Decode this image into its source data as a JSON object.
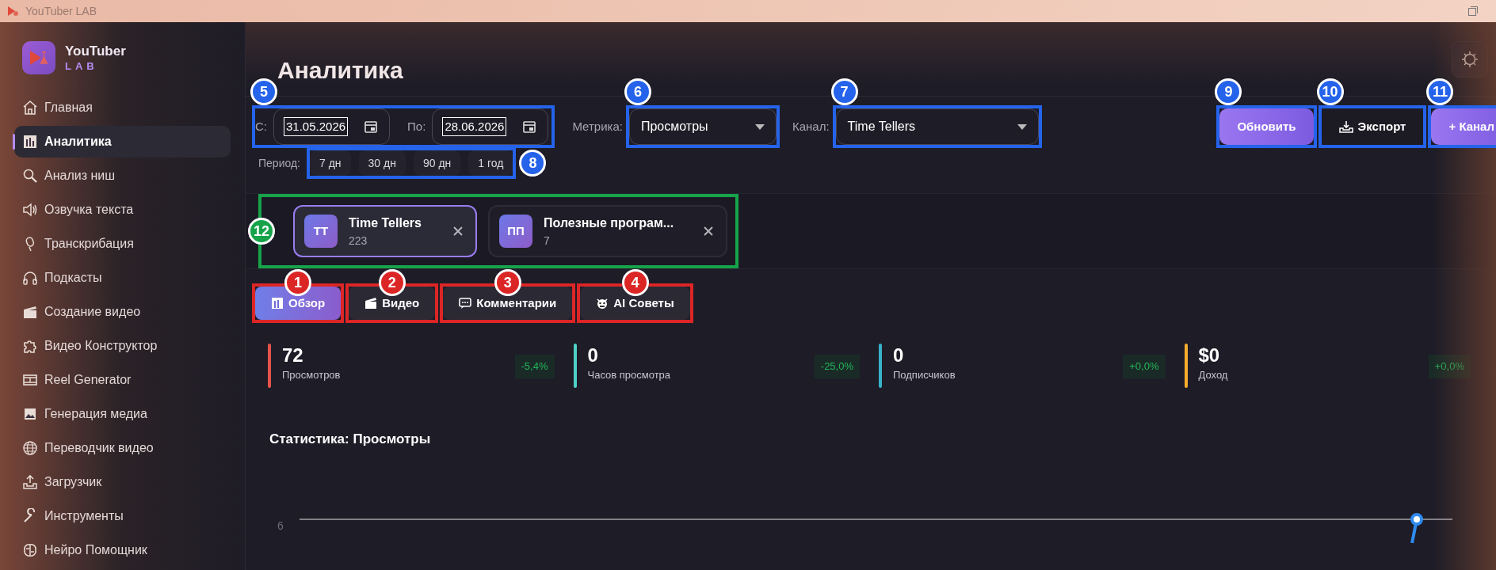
{
  "window": {
    "title": "YouTuber LAB"
  },
  "sidebar": {
    "logo": {
      "line1": "YouTuber",
      "line2": "LAB"
    },
    "items": [
      {
        "label": "Главная",
        "selected": false
      },
      {
        "label": "Аналитика",
        "selected": true
      },
      {
        "label": "Анализ ниш",
        "selected": false
      },
      {
        "label": "Озвучка текста",
        "selected": false
      },
      {
        "label": "Транскрибация",
        "selected": false
      },
      {
        "label": "Подкасты",
        "selected": false
      },
      {
        "label": "Создание видео",
        "selected": false
      },
      {
        "label": "Видео Конструктор",
        "selected": false
      },
      {
        "label": "Reel Generator",
        "selected": false
      },
      {
        "label": "Генерация медиа",
        "selected": false
      },
      {
        "label": "Переводчик видео",
        "selected": false
      },
      {
        "label": "Загрузчик",
        "selected": false
      },
      {
        "label": "Инструменты",
        "selected": false
      },
      {
        "label": "Нейро Помощник",
        "selected": false
      }
    ]
  },
  "page_title": "Аналитика",
  "date_range": {
    "callout": {
      "number": "5",
      "color": "#2563eb"
    },
    "from_label": "С:",
    "from_value": "31.05.2026",
    "to_label": "По:",
    "to_value": "28.06.2026"
  },
  "metric": {
    "callout": {
      "number": "6",
      "color": "#2563eb"
    },
    "label": "Метрика:",
    "value": "Просмотры"
  },
  "channel_select": {
    "callout": {
      "number": "7",
      "color": "#2563eb"
    },
    "label": "Канал:",
    "value": "Time Tellers"
  },
  "buttons": [
    {
      "label": "Обновить",
      "kind": "primary",
      "callout": {
        "number": "9",
        "color": "#2563eb"
      }
    },
    {
      "label": "Экспорт",
      "kind": "export",
      "callout": {
        "number": "10",
        "color": "#2563eb"
      }
    },
    {
      "label": "+ Канал",
      "kind": "primary",
      "callout": {
        "number": "11",
        "color": "#2563eb"
      }
    }
  ],
  "period": {
    "label": "Период:",
    "callout": {
      "number": "8",
      "color": "#2563eb"
    },
    "options": [
      "7 дн",
      "30 дн",
      "90 дн",
      "1 год"
    ]
  },
  "channels": {
    "callout": {
      "number": "12",
      "color": "#16a34a"
    },
    "items": [
      {
        "initials": "TT",
        "name": "Time Tellers",
        "count": "223",
        "selected": true
      },
      {
        "initials": "ПП",
        "name": "Полезные програм...",
        "count": "7",
        "selected": false
      }
    ]
  },
  "tabs": [
    {
      "label": "Обзор",
      "selected": true,
      "callout": {
        "number": "1",
        "color": "#dc2626"
      }
    },
    {
      "label": "Видео",
      "selected": false,
      "callout": {
        "number": "2",
        "color": "#dc2626"
      }
    },
    {
      "label": "Комментарии",
      "selected": false,
      "callout": {
        "number": "3",
        "color": "#dc2626"
      }
    },
    {
      "label": "AI Советы",
      "selected": false,
      "callout": {
        "number": "4",
        "color": "#dc2626"
      }
    }
  ],
  "stats": [
    {
      "value": "72",
      "label": "Просмотров",
      "change": "-5,4%",
      "color": "#e5534b"
    },
    {
      "value": "0",
      "label": "Часов просмотра",
      "change": "-25,0%",
      "color": "#4fd1c5"
    },
    {
      "value": "0",
      "label": "Подписчиков",
      "change": "+0,0%",
      "color": "#38b2c9"
    },
    {
      "value": "$0",
      "label": "Доход",
      "change": "+0,0%",
      "color": "#f6ad2e"
    }
  ],
  "chart": {
    "title": "Статистика: Просмотры",
    "y_tick": "6"
  }
}
